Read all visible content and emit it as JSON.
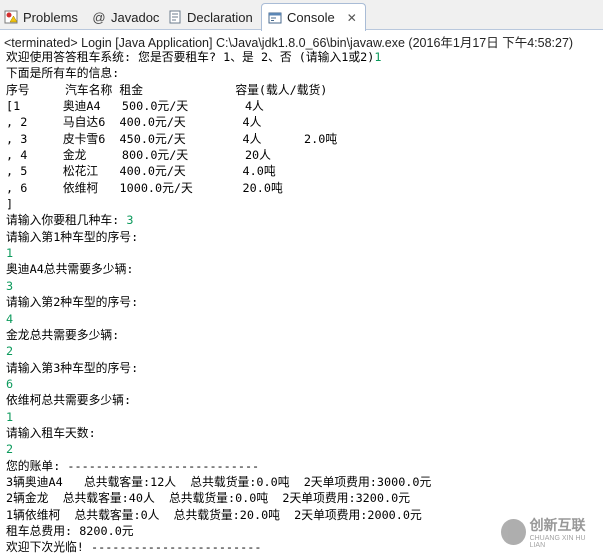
{
  "tabs": [
    {
      "label": "Problems",
      "icon": "problems-icon"
    },
    {
      "label": "Javadoc",
      "icon": "at-sign-icon"
    },
    {
      "label": "Declaration",
      "icon": "declaration-icon"
    },
    {
      "label": "Console",
      "icon": "console-icon",
      "close": "✕"
    }
  ],
  "status": "<terminated> Login [Java Application] C:\\Java\\jdk1.8.0_66\\bin\\javaw.exe (2016年1月17日 下午4:58:27)",
  "console": {
    "prompt_rent": "欢迎使用答答租车系统: 您是否要租车? 1、是 2、否 (请输入1或2)",
    "answer_rent": "1",
    "all_cars": "下面是所有车的信息:",
    "header": "序号     汽车名称 租金             容量(载人/载货)",
    "row1": "[1      奥迪A4   500.0元/天        4人",
    "row2": ", 2     马自达6  400.0元/天        4人",
    "row3": ", 3     皮卡雪6  450.0元/天        4人      2.0吨",
    "row4": ", 4     金龙     800.0元/天        20人",
    "row5": ", 5     松花江   400.0元/天        4.0吨",
    "row6": ", 6     依维柯   1000.0元/天       20.0吨",
    "close_bracket": "]",
    "prompt_kinds": "请输入你要租几种车: ",
    "answer_kinds": "3",
    "prompt_type1": "请输入第1种车型的序号:",
    "answer_type1": "1",
    "prompt_qty1": "奥迪A4总共需要多少辆:",
    "answer_qty1": "3",
    "prompt_type2": "请输入第2种车型的序号:",
    "answer_type2": "4",
    "prompt_qty2": "金龙总共需要多少辆:",
    "answer_qty2": "2",
    "prompt_type3": "请输入第3种车型的序号:",
    "answer_type3": "6",
    "prompt_qty3": "依维柯总共需要多少辆:",
    "answer_qty3": "1",
    "prompt_days": "请输入租车天数:",
    "answer_days": "2",
    "bill": "您的账单: ---------------------------",
    "bill1": "3辆奥迪A4   总共载客量:12人  总共载货量:0.0吨  2天单项费用:3000.0元",
    "bill2": "2辆金龙  总共载客量:40人  总共载货量:0.0吨  2天单项费用:3200.0元",
    "bill3": "1辆依维柯  总共载客量:0人  总共载货量:20.0吨  2天单项费用:2000.0元",
    "total": "租车总费用: 8200.0元",
    "bye": "欢迎下次光临! ------------------------"
  },
  "watermark": {
    "cn": "创新互联",
    "en": "CHUANG XIN HU LIAN"
  }
}
